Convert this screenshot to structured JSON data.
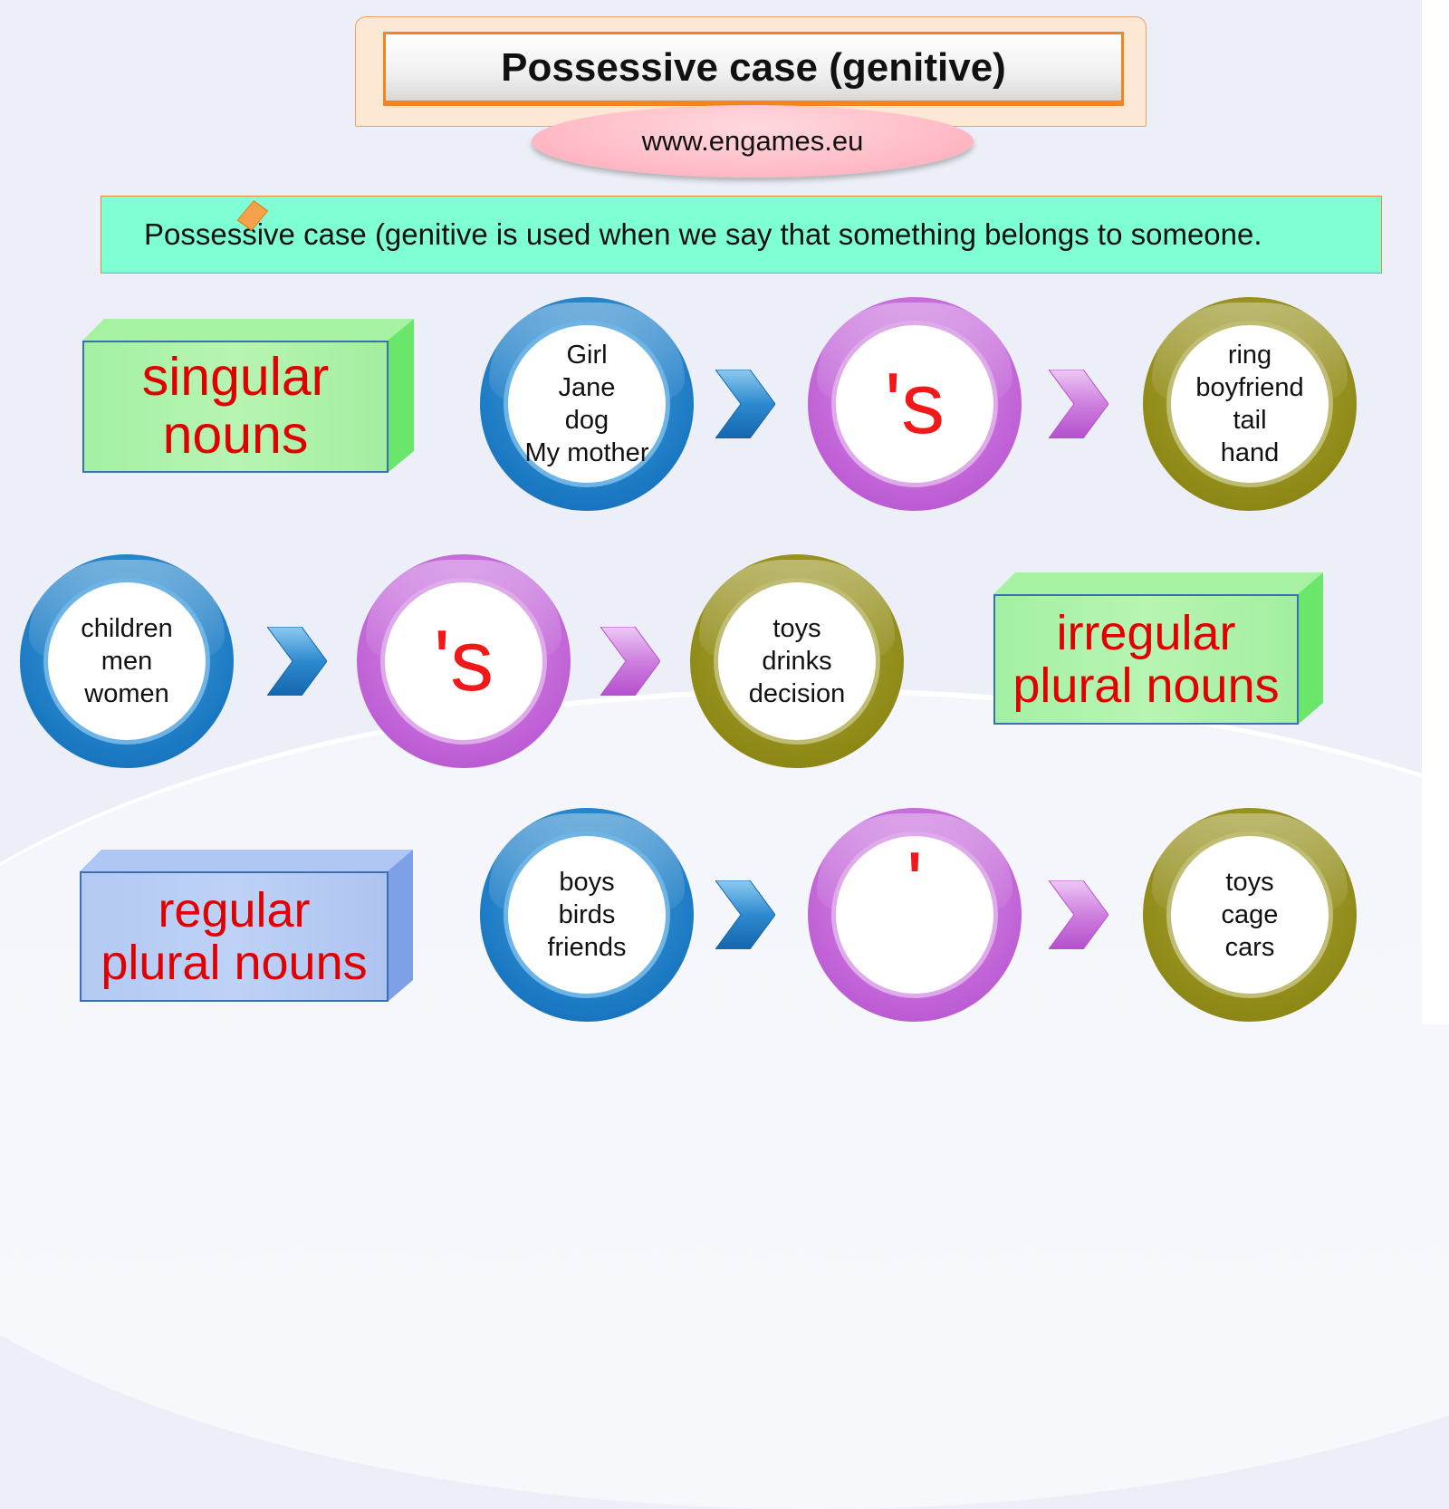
{
  "header": {
    "title": "Possessive case (genitive)",
    "website": "www.engames.eu"
  },
  "definition": {
    "text": "Possessive case (genitive is used when we say that something belongs to someone."
  },
  "categories": {
    "singular": {
      "line1": "singular",
      "line2": "nouns"
    },
    "irregular": {
      "line1": "irregular",
      "line2": "plural nouns"
    },
    "regular": {
      "line1": "regular",
      "line2": "plural nouns"
    }
  },
  "rows": [
    {
      "name": "singular",
      "owners": [
        "Girl",
        "Jane",
        "dog",
        "My mother"
      ],
      "marker": "'s",
      "possessions": [
        "ring",
        "boyfriend",
        "tail",
        "hand"
      ]
    },
    {
      "name": "irregular-plural",
      "owners": [
        "children",
        "men",
        "women"
      ],
      "marker": "'s",
      "possessions": [
        "toys",
        "drinks",
        "decision"
      ]
    },
    {
      "name": "regular-plural",
      "owners": [
        "boys",
        "birds",
        "friends"
      ],
      "marker": "'",
      "possessions": [
        "toys",
        "cage",
        "cars"
      ]
    }
  ],
  "colors": {
    "owner_ring": "#1a78c2",
    "marker_ring": "#bf5fd6",
    "possession_ring": "#8f8a17",
    "marker_text": "#f01818",
    "category_text": "#e00000",
    "title_border": "#f4841f",
    "definition_bg": "#7fffd4"
  }
}
